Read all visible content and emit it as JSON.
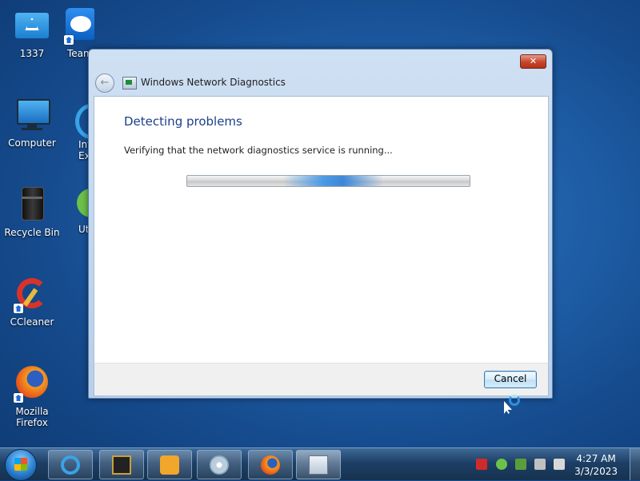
{
  "desktop": {
    "icons": [
      {
        "label": "1337"
      },
      {
        "label": "Team"
      },
      {
        "label": "Computer"
      },
      {
        "label": "Int\nEx"
      },
      {
        "label": "Recycle Bin"
      },
      {
        "label": "Ut"
      },
      {
        "label": "CCleaner"
      },
      {
        "label": "Mozilla Firefox"
      }
    ]
  },
  "window": {
    "title": "Windows Network Diagnostics",
    "close_label": "✕",
    "heading": "Detecting problems",
    "status": "Verifying that the network diagnostics service is running...",
    "cancel_label": "Cancel"
  },
  "taskbar": {
    "time": "4:27 AM",
    "date": "3/3/2023"
  },
  "colors": {
    "heading": "#1b3f8b",
    "accent": "#2d7ed8"
  }
}
